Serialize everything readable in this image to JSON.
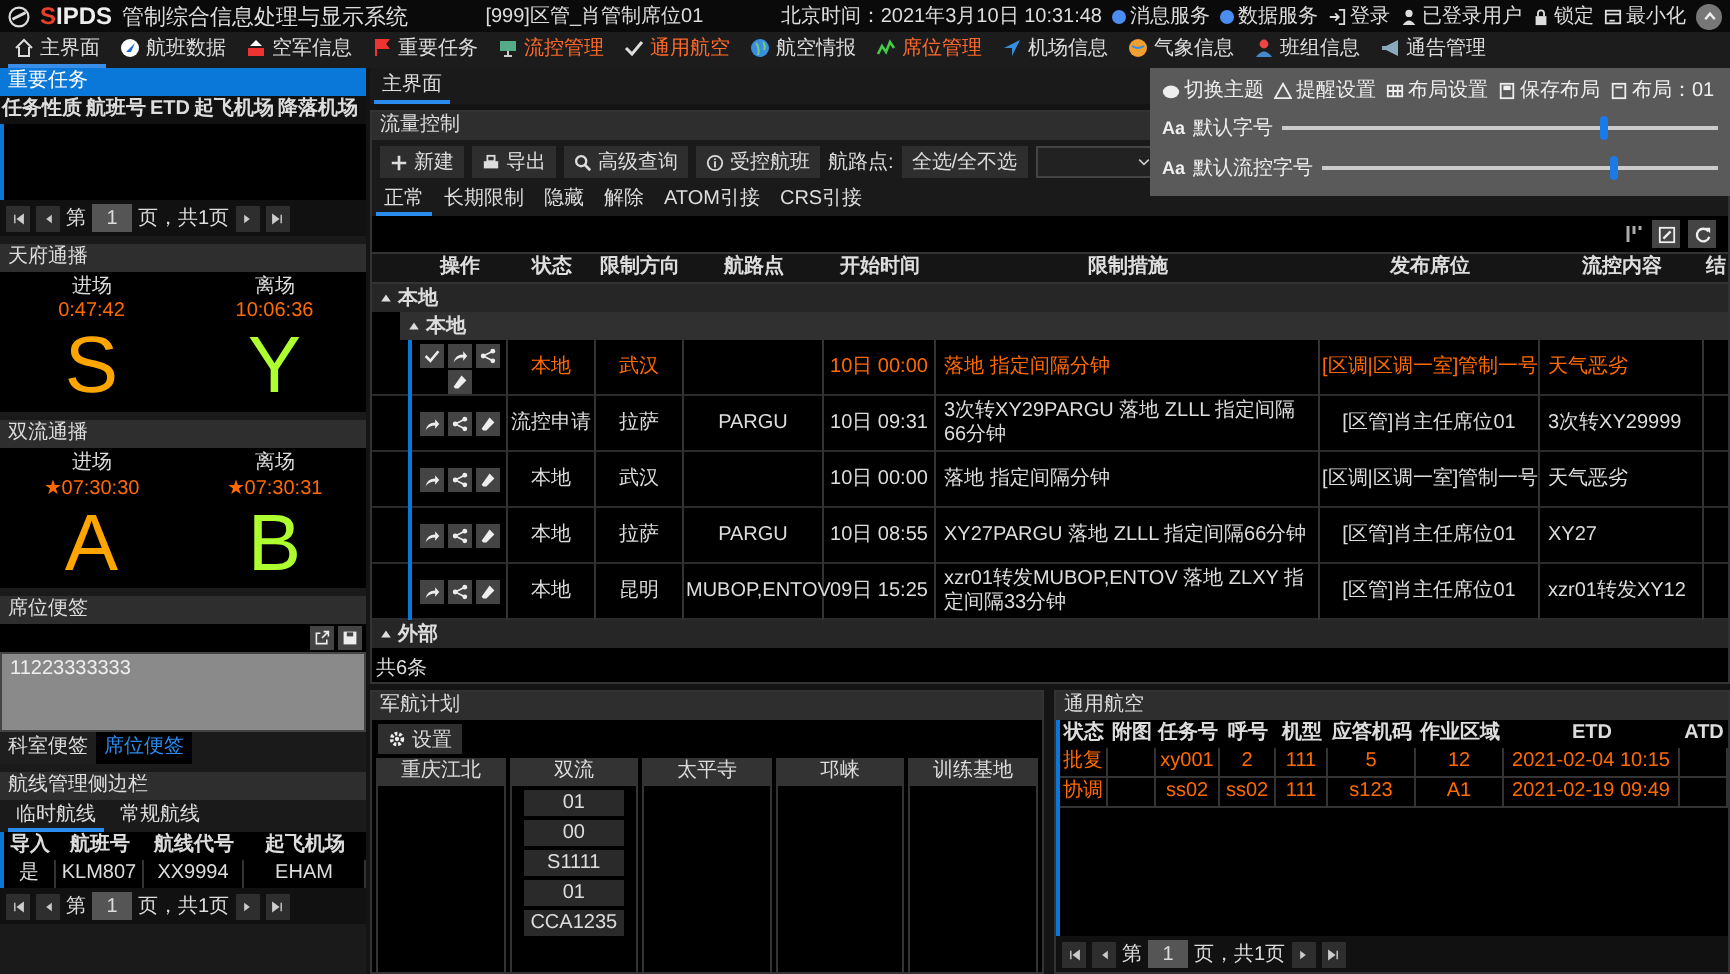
{
  "header": {
    "logo": "SIPDS",
    "system_name": "管制综合信息处理与显示系统",
    "title": "[999]区管_肖管制席位01",
    "clock": "北京时间：2021年3月10日 10:31:48",
    "services": [
      {
        "label": "消息服务",
        "color": "#4a8cf0"
      },
      {
        "label": "数据服务",
        "color": "#4a8cf0"
      }
    ],
    "actions": [
      "登录",
      "已登录用户",
      "锁定",
      "最小化"
    ]
  },
  "nav": [
    {
      "label": "主界面",
      "selected": true,
      "highlight": false
    },
    {
      "label": "航班数据",
      "selected": false,
      "highlight": false
    },
    {
      "label": "空军信息",
      "selected": false,
      "highlight": false
    },
    {
      "label": "重要任务",
      "selected": false,
      "highlight": false
    },
    {
      "label": "流控管理",
      "selected": false,
      "highlight": true
    },
    {
      "label": "通用航空",
      "selected": false,
      "highlight": true
    },
    {
      "label": "航空情报",
      "selected": false,
      "highlight": false
    },
    {
      "label": "席位管理",
      "selected": false,
      "highlight": true
    },
    {
      "label": "机场信息",
      "selected": false,
      "highlight": false
    },
    {
      "label": "气象信息",
      "selected": false,
      "highlight": false
    },
    {
      "label": "班组信息",
      "selected": false,
      "highlight": false
    },
    {
      "label": "通告管理",
      "selected": false,
      "highlight": false
    }
  ],
  "settings_popup": {
    "actions": [
      "切换主题",
      "提醒设置",
      "布局设置",
      "保存布局",
      "布局：01"
    ],
    "sliders": [
      {
        "glyph": "Aa",
        "label": "默认字号",
        "level": 0.74
      },
      {
        "glyph": "Aa",
        "label": "默认流控字号",
        "level": 0.74
      }
    ]
  },
  "important_tasks": {
    "title": "重要任务",
    "columns": [
      "任务性质",
      "航班号",
      "ETD",
      "起飞机场",
      "降落机场"
    ],
    "pager": {
      "prefix": "第",
      "page": "1",
      "suffix": "页，共1页"
    }
  },
  "broadcasts": [
    {
      "title": "天府通播",
      "items": [
        {
          "label": "进场",
          "time": "0:47:42",
          "code": "S",
          "color": "#ffa500"
        },
        {
          "label": "离场",
          "time": "10:06:36",
          "code": "Y",
          "color": "#adff2f"
        }
      ]
    },
    {
      "title": "双流通播",
      "items": [
        {
          "label": "进场",
          "time": "★07:30:30",
          "code": "A",
          "color": "#ffa500"
        },
        {
          "label": "离场",
          "time": "★07:30:31",
          "code": "B",
          "color": "#adff2f"
        }
      ]
    }
  ],
  "seat_note": {
    "title": "席位便签",
    "text": "11223333333",
    "tabs": [
      {
        "label": "科室便签",
        "selected": false
      },
      {
        "label": "席位便签",
        "selected": true
      }
    ]
  },
  "route_sidebar": {
    "title": "航线管理侧边栏",
    "tabs": [
      {
        "label": "临时航线",
        "selected": true
      },
      {
        "label": "常规航线",
        "selected": false
      }
    ],
    "columns": [
      "导入",
      "航班号",
      "航线代号",
      "起飞机场"
    ],
    "rows": [
      [
        "是",
        "KLM807",
        "XX9994",
        "EHAM"
      ]
    ],
    "pager": {
      "prefix": "第",
      "page": "1",
      "suffix": "页，共1页"
    }
  },
  "main_tabs": [
    {
      "label": "主界面",
      "selected": true
    }
  ],
  "flow_control": {
    "title": "流量控制",
    "toolbar": [
      "新建",
      "导出",
      "高级查询",
      "受控航班"
    ],
    "waypoint_label": "航路点:",
    "waypoint_select": "全选/全不选",
    "tabs": [
      {
        "label": "正常",
        "selected": true
      },
      {
        "label": "长期限制",
        "selected": false
      },
      {
        "label": "隐藏",
        "selected": false
      },
      {
        "label": "解除",
        "selected": false
      },
      {
        "label": "ATOM引接",
        "selected": false
      },
      {
        "label": "CRS引接",
        "selected": false
      }
    ],
    "columns": [
      "操作",
      "状态",
      "限制方向",
      "航路点",
      "开始时间",
      "限制措施",
      "发布席位",
      "流控内容",
      "结"
    ],
    "groups": [
      {
        "label": "本地",
        "expanded": true,
        "children": [
          {
            "label": "本地",
            "expanded": true,
            "rows": [
              {
                "highlight": true,
                "confirmable": true,
                "status": "本地",
                "direction": "武汉",
                "start": "10日 00:00",
                "measure": "落地  指定间隔分钟",
                "seat": "[区调|区调一室]管制一号",
                "content": "天气恶劣"
              },
              {
                "highlight": false,
                "confirmable": false,
                "status": "流控申请",
                "direction": "拉萨",
                "waypoint": "PARGU",
                "start": "10日 09:31",
                "measure": "3次转XY29PARGU 落地 ZLLL 指定间隔66分钟",
                "seat": "[区管]肖主任席位01",
                "content": "3次转XY29999"
              },
              {
                "highlight": false,
                "confirmable": false,
                "status": "本地",
                "direction": "武汉",
                "start": "10日 00:00",
                "measure": "落地  指定间隔分钟",
                "seat": "[区调|区调一室]管制一号",
                "content": "天气恶劣"
              },
              {
                "highlight": false,
                "confirmable": false,
                "status": "本地",
                "direction": "拉萨",
                "waypoint": "PARGU",
                "start": "10日 08:55",
                "measure": "XY27PARGU 落地 ZLLL 指定间隔66分钟",
                "seat": "[区管]肖主任席位01",
                "content": "XY27"
              },
              {
                "highlight": false,
                "confirmable": false,
                "status": "本地",
                "direction": "昆明",
                "waypoint": "MUBOP,ENTOV",
                "start": "09日 15:25",
                "measure": "xzr01转发MUBOP,ENTOV 落地 ZLXY 指定间隔33分钟",
                "seat": "[区管]肖主任席位01",
                "content": "xzr01转发XY12"
              }
            ]
          }
        ]
      },
      {
        "label": "外部",
        "expanded": true
      }
    ],
    "total": "共6条"
  },
  "military_plan": {
    "title": "军航计划",
    "settings_button": "设置",
    "columns": [
      {
        "label": "重庆江北"
      },
      {
        "label": "双流",
        "items": [
          "01",
          "00",
          "S1111",
          "01",
          "CCA1235"
        ]
      },
      {
        "label": "太平寺"
      },
      {
        "label": "邛崃"
      },
      {
        "label": "训练基地"
      }
    ]
  },
  "general_aviation": {
    "title": "通用航空",
    "columns": [
      "状态",
      "附图",
      "任务号",
      "呼号",
      "机型",
      "应答机码",
      "作业区域",
      "ETD",
      "ATD"
    ],
    "rows": [
      {
        "status": "批复",
        "task": "xy001",
        "callsign": "2",
        "type": "111",
        "squawk": "5",
        "area": "12",
        "etd": "2021-02-04 10:15"
      },
      {
        "status": "协调",
        "task": "ss02",
        "callsign": "ss02",
        "type": "111",
        "squawk": "s123",
        "area": "A1",
        "etd": "2021-02-19 09:49"
      }
    ],
    "pager": {
      "prefix": "第",
      "page": "1",
      "suffix": "页，共1页"
    }
  }
}
